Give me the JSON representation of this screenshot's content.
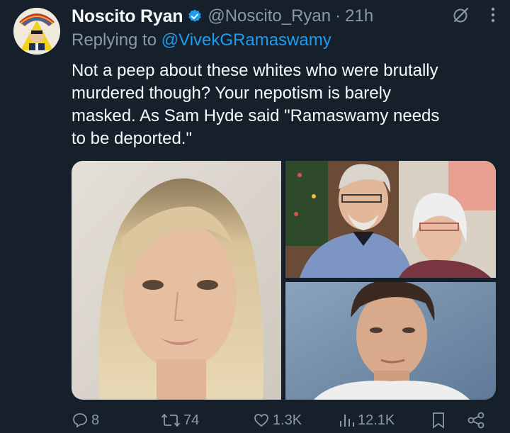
{
  "tweet": {
    "display_name": "Noscito Ryan",
    "handle": "@Noscito_Ryan",
    "separator": "·",
    "time": "21h",
    "reply_prefix": "Replying to ",
    "reply_to": "@VivekGRamaswamy",
    "text": "Not a peep about these whites who were brutally\nmurdered though?  Your nepotism is barely\nmasked.  As Sam Hyde said \"Ramaswamy needs\nto be deported.\""
  },
  "icons": {
    "verified": "verified-badge-icon",
    "grok": "grok-icon",
    "more": "more-icon"
  },
  "metrics": {
    "replies": "8",
    "reposts": "74",
    "likes": "1.3K",
    "views": "12.1K"
  },
  "colors": {
    "background": "#15202b",
    "text": "#f7f9f9",
    "muted": "#8b98a5",
    "accent": "#1d9bf0"
  }
}
